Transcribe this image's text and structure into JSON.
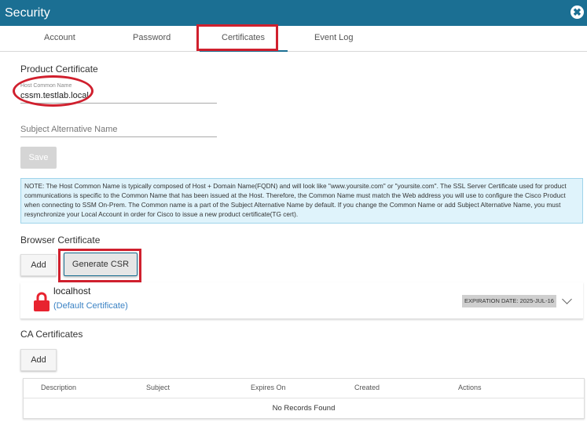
{
  "window": {
    "title": "Security",
    "close_glyph": "✖"
  },
  "tabs": [
    {
      "label": "Account",
      "active": false
    },
    {
      "label": "Password",
      "active": false
    },
    {
      "label": "Certificates",
      "active": true
    },
    {
      "label": "Event Log",
      "active": false
    }
  ],
  "product_certificate": {
    "heading": "Product Certificate",
    "host_common_name_label": "Host Common Name",
    "host_common_name_value": "cssm.testlab.local",
    "subject_alt_name_placeholder": "Subject Alternative Name",
    "save_label": "Save",
    "note": "NOTE: The Host Common Name is typically composed of Host + Domain Name(FQDN) and will look like \"www.yoursite.com\" or \"yoursite.com\". The SSL Server Certificate used for product communications is specific to the Common Name that has been issued at the Host. Therefore, the Common Name must match the Web address you will use to configure the Cisco Product when connecting to SSM On-Prem. The Common name is a part of the Subject Alternative Name by default. If you change the Common Name or add Subject Alternative Name, you must resynchronize your Local Account in order for Cisco to issue a new product certificate(TG cert)."
  },
  "browser_certificate": {
    "heading": "Browser Certificate",
    "add_label": "Add",
    "generate_csr_label": "Generate CSR",
    "cert": {
      "name": "localhost",
      "subtitle": "(Default Certificate)",
      "expiration": "EXPIRATION DATE:  2025-JUL-16",
      "icon": "lock-icon"
    }
  },
  "ca_certificates": {
    "heading": "CA Certificates",
    "add_label": "Add",
    "columns": [
      "Description",
      "Subject",
      "Expires On",
      "Created",
      "Actions"
    ],
    "empty_text": "No Records Found"
  },
  "colors": {
    "titlebar": "#1b6f93",
    "highlight": "#d0202e",
    "note_bg": "#dff3fb",
    "link": "#3a82c4"
  }
}
